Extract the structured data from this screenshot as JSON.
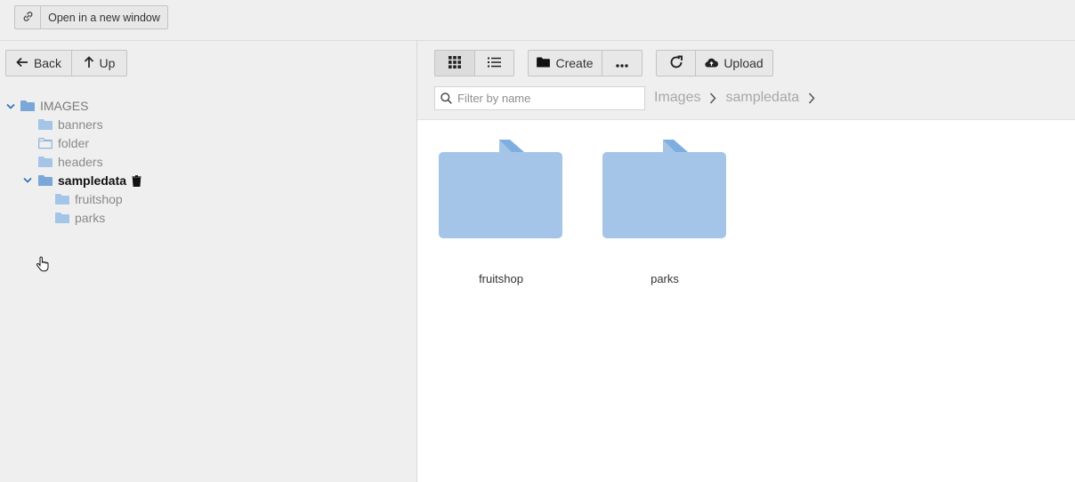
{
  "topbar": {
    "open_window_label": "Open in a new window",
    "link_icon": "link-icon"
  },
  "nav": {
    "back_label": "Back",
    "up_label": "Up"
  },
  "tree": {
    "root": {
      "label": "IMAGES",
      "expanded": true
    },
    "items": [
      {
        "label": "banners",
        "level": 1
      },
      {
        "label": "folder",
        "level": 1,
        "outline": true
      },
      {
        "label": "headers",
        "level": 1
      },
      {
        "label": "sampledata",
        "level": 1,
        "expanded": true,
        "selected": true
      },
      {
        "label": "fruitshop",
        "level": 2
      },
      {
        "label": "parks",
        "level": 2
      }
    ]
  },
  "toolbar": {
    "grid_view_icon": "grid-icon",
    "list_view_icon": "list-icon",
    "create_label": "Create",
    "more_icon": "more-icon",
    "refresh_icon": "refresh-icon",
    "upload_label": "Upload"
  },
  "filter": {
    "placeholder": "Filter by name",
    "value": ""
  },
  "breadcrumb": [
    "Images",
    "sampledata"
  ],
  "files": [
    {
      "name": "fruitshop",
      "type": "folder"
    },
    {
      "name": "parks",
      "type": "folder"
    }
  ],
  "colors": {
    "folder": "#a4c5e8",
    "folder_tab": "#7eaee0",
    "folder_dark": "#7ba6d8",
    "background": "#efefef",
    "content": "#ffffff"
  }
}
